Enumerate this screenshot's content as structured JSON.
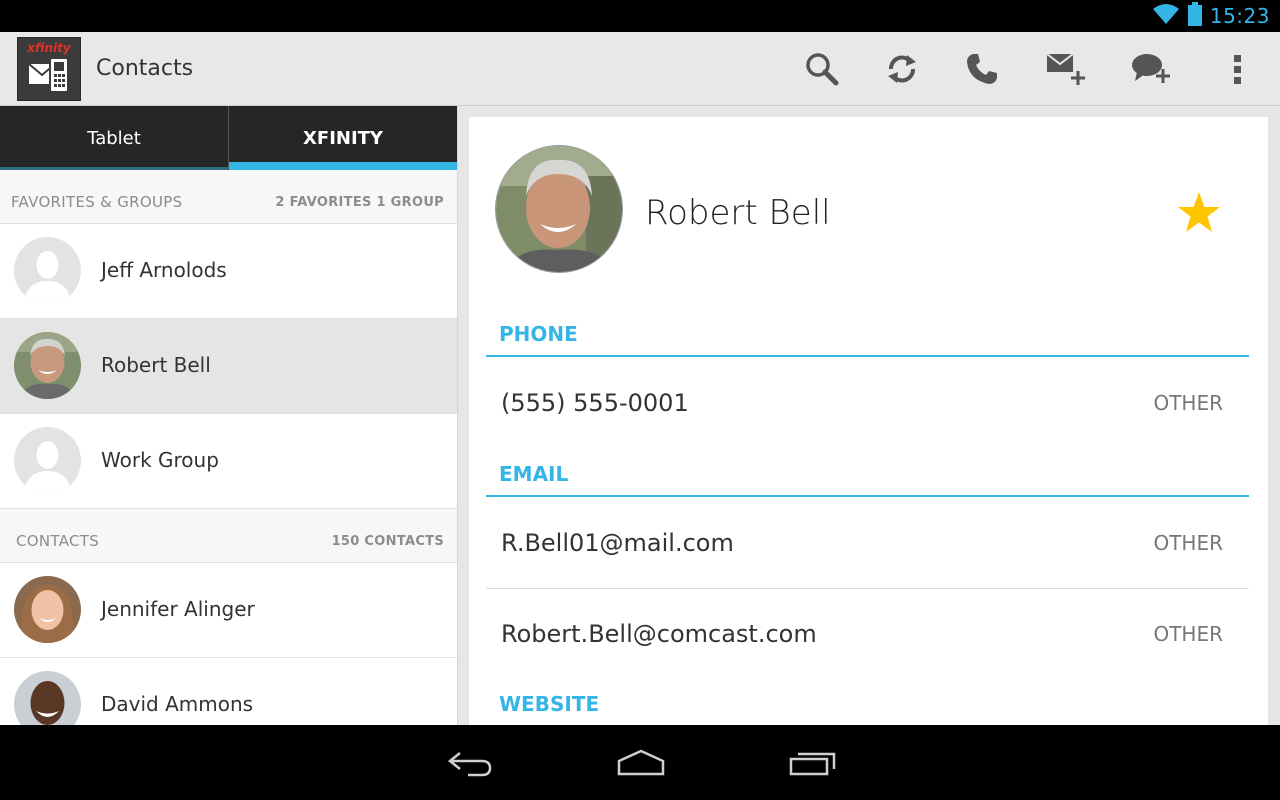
{
  "status_bar": {
    "time": "15:23",
    "icons": [
      "wifi-icon",
      "battery-icon"
    ],
    "accent_color": "#33b5e5"
  },
  "action_bar": {
    "app_logo_text": "xfinity",
    "title": "Contacts",
    "actions": [
      "search-icon",
      "sync-icon",
      "phone-icon",
      "new-mail-icon",
      "new-message-icon",
      "overflow-menu-icon"
    ]
  },
  "tabs": [
    {
      "label": "Tablet",
      "selected": false
    },
    {
      "label": "XFINITY",
      "selected": true
    }
  ],
  "favorites_section": {
    "title": "FAVORITES & GROUPS",
    "count": "2 FAVORITES 1 GROUP",
    "items": [
      {
        "name": "Jeff Arnolods",
        "avatar": "placeholder"
      },
      {
        "name": "Robert Bell",
        "avatar": "photo",
        "selected": true
      },
      {
        "name": "Work Group",
        "avatar": "placeholder"
      }
    ]
  },
  "contacts_section": {
    "title": "CONTACTS",
    "count": "150 CONTACTS",
    "items": [
      {
        "name": "Jennifer Alinger",
        "avatar": "photo"
      },
      {
        "name": "David Ammons",
        "avatar": "photo"
      }
    ]
  },
  "detail": {
    "name": "Robert Bell",
    "favorite": true,
    "star_color": "#ffc600",
    "phone_header": "PHONE",
    "phone": {
      "value": "(555) 555-0001",
      "type": "OTHER"
    },
    "email_header": "EMAIL",
    "emails": [
      {
        "value": "R.Bell01@mail.com",
        "type": "OTHER"
      },
      {
        "value": "Robert.Bell@comcast.com",
        "type": "OTHER"
      }
    ],
    "website_header": "WEBSITE"
  },
  "nav_bar": {
    "buttons": [
      "back-icon",
      "home-icon",
      "recent-apps-icon"
    ]
  }
}
